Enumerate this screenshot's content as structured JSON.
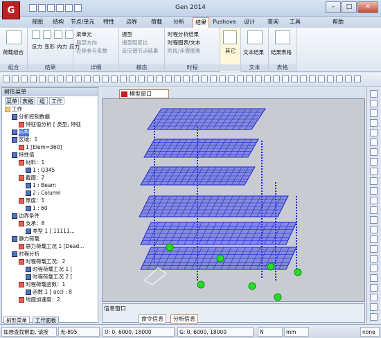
{
  "app": {
    "title": "Gen 2014",
    "help": "帮助",
    "logo": "G"
  },
  "menu_tabs": [
    "视图",
    "结构",
    "节点/单元",
    "特性",
    "边界",
    "荷载",
    "分析",
    "结果",
    "Pushove",
    "设计",
    "查询",
    "工具"
  ],
  "ribbon": {
    "groups": [
      {
        "label": "组合",
        "items": [
          "荷载组合"
        ]
      },
      {
        "label": "结果",
        "items": [
          "反力",
          "变形",
          "内力",
          "应力"
        ]
      },
      {
        "label": "详细",
        "items": [
          "梁单元",
          "局部方向",
          "位移参与系数"
        ]
      },
      {
        "label": "模态",
        "items": [
          "振型",
          "振型阻尼比",
          "反应谱节点结果"
        ]
      },
      {
        "label": "时程",
        "items": [
          "时程分析结果",
          "时程图表/文本",
          "阶段/步骤图表"
        ]
      },
      {
        "label": "",
        "items": [
          "其它"
        ]
      },
      {
        "label": "文本",
        "items": [
          "文本结果"
        ]
      },
      {
        "label": "表格",
        "items": [
          "结果表格"
        ]
      }
    ]
  },
  "left_panel": {
    "title": "树形菜单",
    "tabs": [
      "菜单",
      "表格",
      "组",
      "工作"
    ],
    "tree": [
      {
        "t": "工作",
        "lvl": 0
      },
      {
        "t": "分析控制数据",
        "lvl": 1
      },
      {
        "t": "特征值分析 [ 类型, 特征",
        "lvl": 2
      },
      {
        "t": "结构",
        "lvl": 1,
        "sel": true
      },
      {
        "t": "区域：1",
        "lvl": 1
      },
      {
        "t": "1 [Elem=360]",
        "lvl": 2
      },
      {
        "t": "特性值",
        "lvl": 1
      },
      {
        "t": "材料：1",
        "lvl": 2
      },
      {
        "t": "1 : Q345",
        "lvl": 3
      },
      {
        "t": "截面：2",
        "lvl": 2
      },
      {
        "t": "1 : Beam",
        "lvl": 3
      },
      {
        "t": "2 : Column",
        "lvl": 3
      },
      {
        "t": "厚度：1",
        "lvl": 2
      },
      {
        "t": "1 : 60",
        "lvl": 3
      },
      {
        "t": "边界条件",
        "lvl": 1
      },
      {
        "t": "支承：8",
        "lvl": 2
      },
      {
        "t": "类型 1 [ 11111...",
        "lvl": 3
      },
      {
        "t": "静力荷载",
        "lvl": 1
      },
      {
        "t": "静力荷载工况 1 [Dead...",
        "lvl": 2
      },
      {
        "t": "时程分析",
        "lvl": 1
      },
      {
        "t": "时程荷载工况：2",
        "lvl": 2
      },
      {
        "t": "时程荷载工况 1 [",
        "lvl": 3
      },
      {
        "t": "时程荷载工况 2 [",
        "lvl": 3
      },
      {
        "t": "时程荷载函数：1",
        "lvl": 2
      },
      {
        "t": "函数 1 [ accl : 8",
        "lvl": 3
      },
      {
        "t": "地面加速度：2",
        "lvl": 2
      }
    ],
    "bottom_tabs": [
      "树形菜单",
      "工作面板"
    ]
  },
  "document_tab": "模型窗口",
  "info_window": {
    "title": "信息窗口",
    "tabs": [
      "命令信息",
      "分析信息"
    ]
  },
  "status": {
    "help": "如想查找帮助, 请按",
    "node": "无-895",
    "coord_u": "U: 0, 6000, 18000",
    "coord_g": "G: 0, 6000, 18000",
    "unit_force": "N",
    "unit_len": "mm",
    "mode": "none"
  },
  "colors": {
    "accent": "#c85",
    "mesh": "#1a24d8",
    "support": "#2bd92b"
  }
}
